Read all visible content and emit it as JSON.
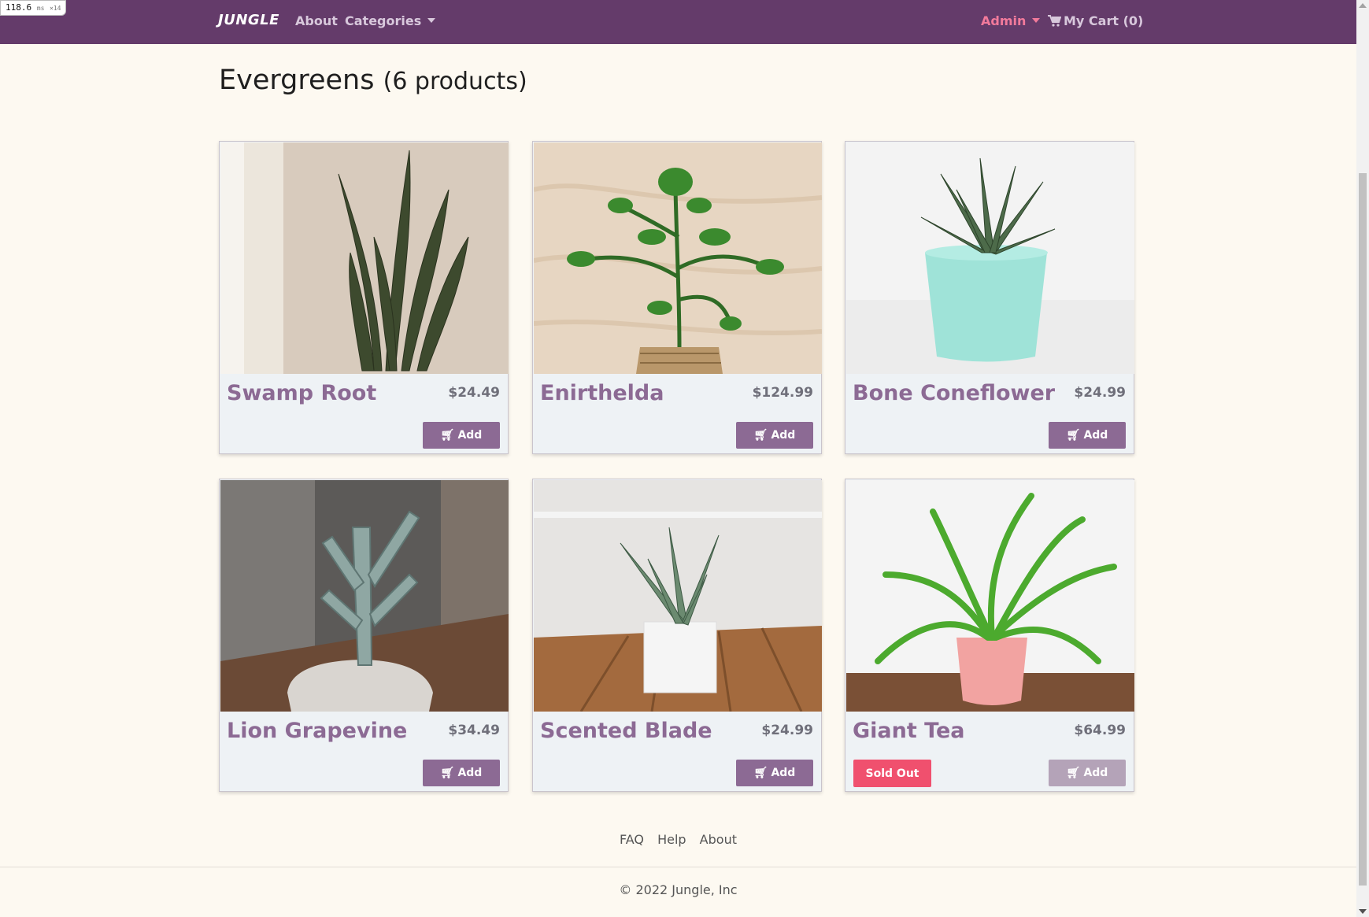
{
  "perf": {
    "ms": "118.6",
    "unit": "ms",
    "suffix": "×14"
  },
  "navbar": {
    "brand": "JUNGLE",
    "links": [
      "About",
      "Categories"
    ],
    "admin": "Admin",
    "cart": "My Cart (0)"
  },
  "page": {
    "heading": "Evergreens",
    "count": "(6 products)"
  },
  "products": [
    {
      "name": "Swamp Root",
      "price": "$24.49",
      "add_label": "Add",
      "sold_out": false,
      "image": "snake-plant"
    },
    {
      "name": "Enirthelda",
      "price": "$124.99",
      "add_label": "Add",
      "sold_out": false,
      "image": "jade-plant-basket"
    },
    {
      "name": "Bone Coneflower",
      "price": "$24.99",
      "add_label": "Add",
      "sold_out": false,
      "image": "aloe-teal-pot"
    },
    {
      "name": "Lion Grapevine",
      "price": "$34.49",
      "add_label": "Add",
      "sold_out": false,
      "image": "cactus-white-pot"
    },
    {
      "name": "Scented Blade",
      "price": "$24.99",
      "add_label": "Add",
      "sold_out": false,
      "image": "succulent-white-pot"
    },
    {
      "name": "Giant Tea",
      "price": "$64.99",
      "add_label": "Add",
      "sold_out": true,
      "sold_out_label": "Sold Out",
      "image": "fern-pink-pot"
    }
  ],
  "footer": {
    "links": [
      "FAQ",
      "Help",
      "About"
    ],
    "copyright": "© 2022 Jungle, Inc"
  },
  "colors": {
    "nav_bg": "#643b6a",
    "accent": "#8c6a94",
    "sold_out": "#f0506e",
    "admin": "#f27a9b",
    "page_bg": "#fdf9f1"
  }
}
